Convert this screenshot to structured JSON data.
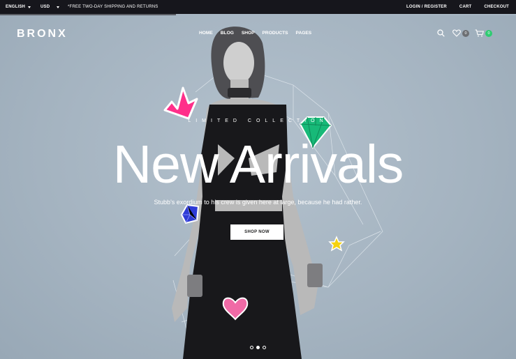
{
  "topbar": {
    "language": "ENGLISH",
    "currency": "USD",
    "promo": "*FREE TWO-DAY SHIPPING AND RETURNS",
    "links": [
      "LOGIN / REGISTER",
      "CART",
      "CHECKOUT"
    ]
  },
  "header": {
    "logo": "BRONX",
    "nav": [
      "HOME",
      "BLOG",
      "SHOP",
      "PRODUCTS",
      "PAGES"
    ],
    "wishlist_count": "0",
    "cart_count": "0"
  },
  "hero": {
    "kicker": "LIMITED COLLECTION",
    "title": "New Arrivals",
    "subtitle": "Stubb's exordium to his crew is given here at large, because he had rather.",
    "button": "SHOP NOW",
    "slides": 3,
    "active_slide": 2
  },
  "colors": {
    "topbar_bg": "#16161c",
    "hero_bg": "#a8b7c4",
    "badge_gray": "#6d6f73",
    "badge_green": "#2ecc71",
    "crown": "#ff2f8a",
    "diamond_green": "#17b978",
    "diamond_blue": "#2e3bd6",
    "star": "#f5d20e",
    "heart": "#f06aa6"
  }
}
